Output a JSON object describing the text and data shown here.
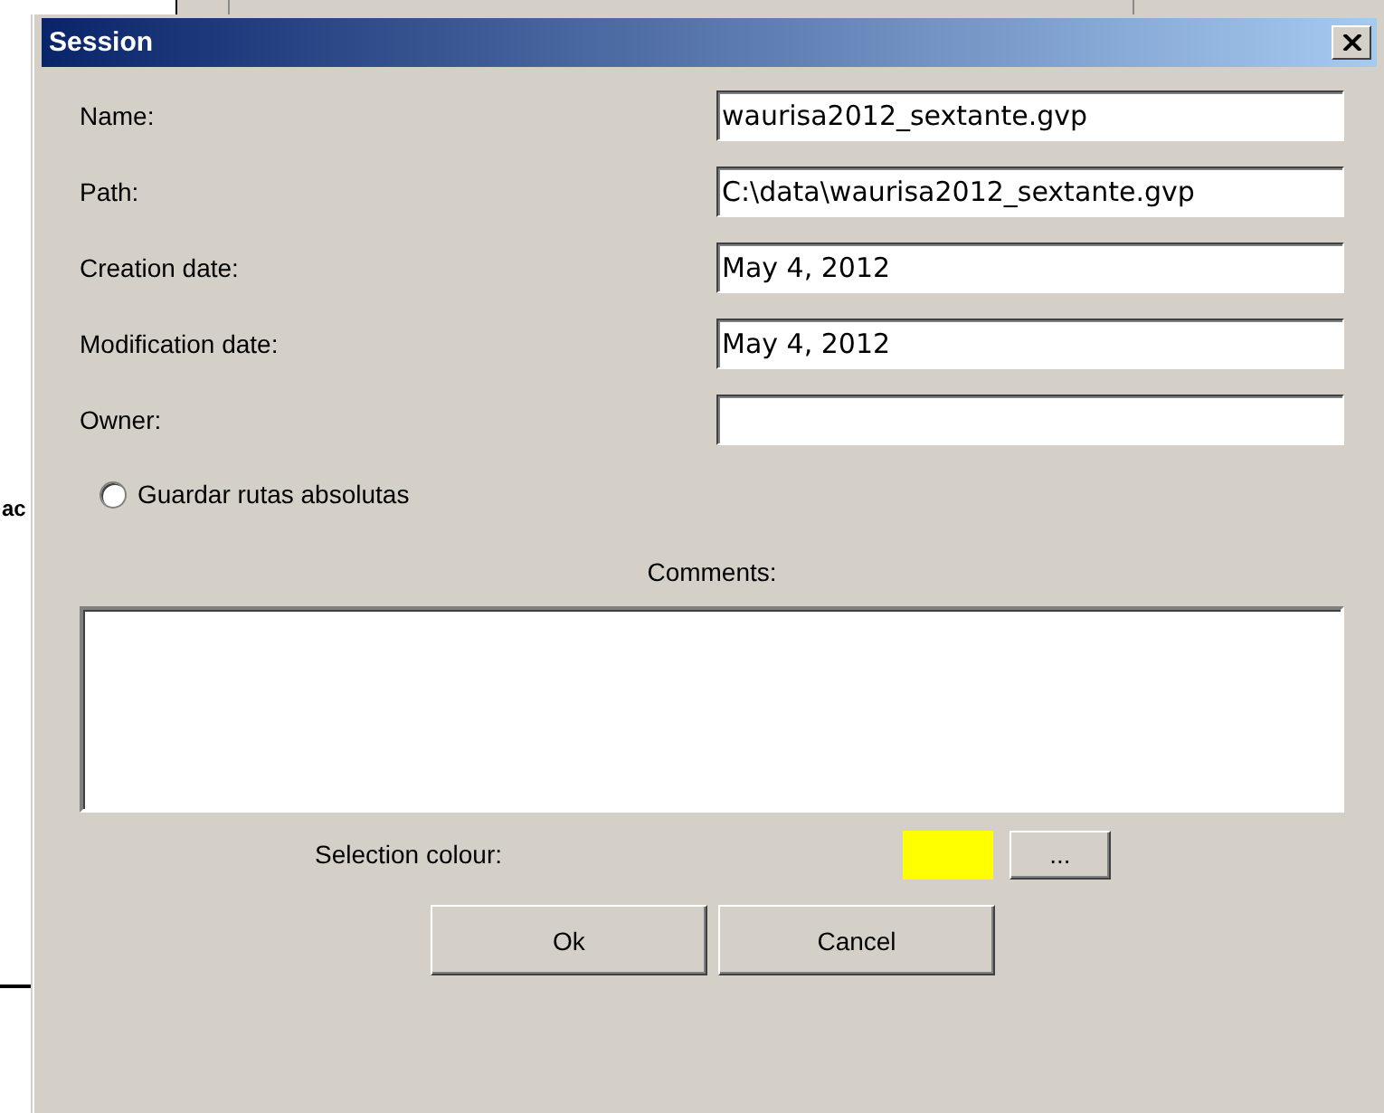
{
  "background": {
    "text_fragment": "ac"
  },
  "window": {
    "title": "Session"
  },
  "fields": [
    {
      "label": "Name:",
      "value": "waurisa2012_sextante.gvp"
    },
    {
      "label": "Path:",
      "value": "C:\\data\\waurisa2012_sextante.gvp"
    },
    {
      "label": "Creation date:",
      "value": "May 4, 2012"
    },
    {
      "label": "Modification date:",
      "value": "May 4, 2012"
    },
    {
      "label": "Owner:"
    }
  ],
  "absolute_paths": {
    "label": "Guardar rutas absolutas",
    "selected": false
  },
  "comments": {
    "label": "Comments:"
  },
  "selection_colour": {
    "label": "Selection colour:",
    "color": "#ffff00",
    "button": "..."
  },
  "buttons": [
    "Ok",
    "Cancel"
  ]
}
